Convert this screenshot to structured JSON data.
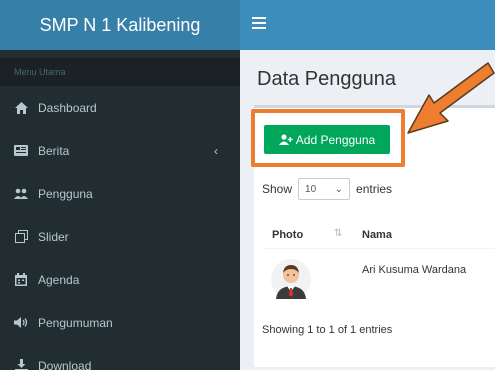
{
  "sidebar": {
    "brand": "SMP N 1 Kalibening",
    "menu_header": "Menu Utama",
    "items": [
      {
        "label": "Dashboard",
        "icon": "home-icon"
      },
      {
        "label": "Berita",
        "icon": "newspaper-icon",
        "has_submenu": true
      },
      {
        "label": "Pengguna",
        "icon": "users-icon"
      },
      {
        "label": "Slider",
        "icon": "clone-icon"
      },
      {
        "label": "Agenda",
        "icon": "calendar-icon"
      },
      {
        "label": "Pengumuman",
        "icon": "volume-icon"
      },
      {
        "label": "Download",
        "icon": "download-icon"
      }
    ]
  },
  "navbar": {
    "toggle": "hamburger-icon"
  },
  "main": {
    "title": "Data Pengguna",
    "add_button": "Add Pengguna",
    "entries": {
      "prefix": "Show",
      "value": "10",
      "suffix": "entries"
    },
    "table": {
      "columns": [
        "Photo",
        "Nama"
      ],
      "rows": [
        {
          "nama": "Ari Kusuma Wardana"
        }
      ]
    },
    "showing": "Showing 1 to 1 of 1 entries"
  },
  "colors": {
    "brand": "#367fa9",
    "navbar": "#3c8dbc",
    "sidebar": "#222d32",
    "button": "#00a65a",
    "highlight": "#ed7d31"
  }
}
